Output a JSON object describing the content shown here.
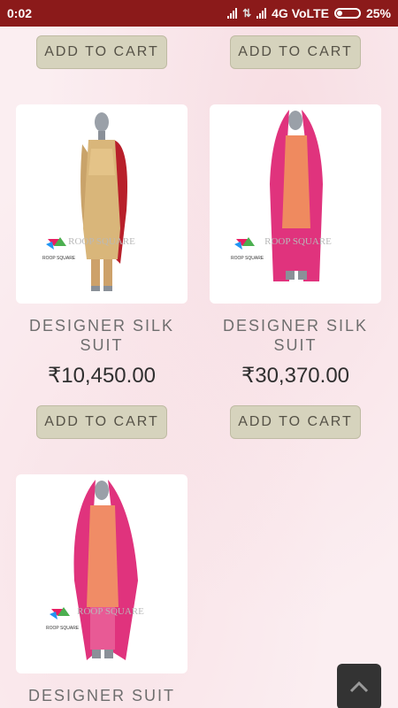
{
  "status": {
    "time": "0:02",
    "network": "4G VoLTE",
    "battery": "25%",
    "battery_level": 0.25
  },
  "products": [
    {
      "title": "",
      "price": "",
      "add_label": "ADD TO CART"
    },
    {
      "title": "",
      "price": "",
      "add_label": "ADD TO CART"
    },
    {
      "title": "DESIGNER SILK SUIT",
      "price": "₹10,450.00",
      "add_label": "ADD TO CART",
      "image_watermark": "ROOP SQUARE"
    },
    {
      "title": "DESIGNER SILK SUIT",
      "price": "₹30,370.00",
      "add_label": "ADD TO CART",
      "image_watermark": "ROOP SQUARE"
    },
    {
      "title": "DESIGNER SUIT",
      "price": "",
      "add_label": "",
      "image_watermark": "ROOP SQUARE"
    }
  ],
  "icons": {
    "scroll_top": "chevron-up-icon",
    "signal": "signal-icon",
    "battery": "battery-icon"
  },
  "colors": {
    "status_bar": "#8b1a1a",
    "button_bg": "#d6d3bd",
    "page_bg": "#fbeef1"
  }
}
